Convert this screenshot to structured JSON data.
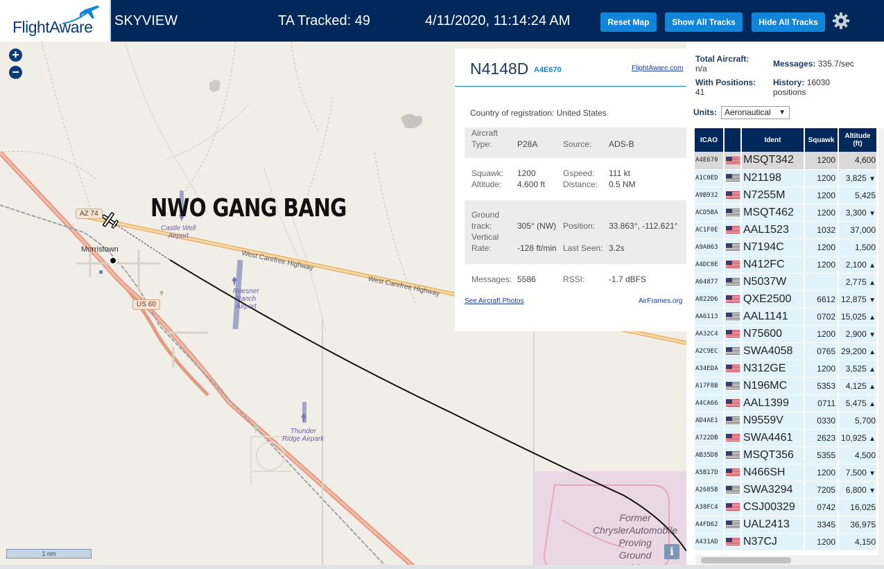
{
  "header": {
    "logo_text": "FlightAware",
    "app_title": "SKYVIEW",
    "ta_tracked": "TA Tracked: 49",
    "datetime": "4/11/2020, 11:14:24 AM",
    "reset_map": "Reset Map",
    "show_all_tracks": "Show All Tracks",
    "hide_all_tracks": "Hide All Tracks",
    "settings_icon": "gear-icon",
    "bg_color": "#00285a",
    "button_color": "#1185d9"
  },
  "map": {
    "zoom_in": "+",
    "zoom_out": "−",
    "overlay_text": "NWO GANG BANG",
    "town": "Morristown",
    "shields": [
      "AZ 74",
      "US 60"
    ],
    "roads": [
      "West Carefree Highway",
      "West Carefree Highway"
    ],
    "airports": [
      {
        "line1": "Castle Well",
        "line2": "Airport"
      },
      {
        "line1": "Roesner",
        "line2": "Ranch",
        "line3": "Airport"
      },
      {
        "line1": "Thunder",
        "line2": "Ridge Airpark"
      }
    ],
    "pink_area": [
      "Former",
      "ChryslerAutomobile",
      "Proving",
      "Ground",
      "sold to"
    ],
    "scale": "1 nm",
    "info": "i"
  },
  "detail": {
    "callsign": "N4148D",
    "icao": "A4E670",
    "flightaware_link": "FlightAware.com",
    "country_label": "Country of registration:",
    "country": "United States",
    "aircraft_type_label1": "Aircraft",
    "aircraft_type_label2": "Type:",
    "aircraft_type": "P28A",
    "source_label": "Source:",
    "source": "ADS-B",
    "squawk_label": "Squawk:",
    "squawk": "1200",
    "gspeed_label": "Gspeed:",
    "gspeed": "111 kt",
    "altitude_label": "Altitude:",
    "altitude": "4,600 ft",
    "distance_label": "Distance:",
    "distance": "0.5 NM",
    "track_label1": "Ground",
    "track_label2": "track:",
    "track": "305° (NW)",
    "position_label": "Position:",
    "position": "33.863°, -112.621°",
    "vrate_label1": "Vertical",
    "vrate_label2": "Rate:",
    "vrate": "-128 ft/min",
    "lastseen_label": "Last Seen:",
    "lastseen": "3.2s",
    "messages_label": "Messages:",
    "messages": "5586",
    "rssi_label": "RSSI:",
    "rssi": "-1.7 dBFS",
    "photos_link": "See Aircraft Photos",
    "airframes_link": "AirFrames.org"
  },
  "stats": {
    "total_label": "Total Aircraft:",
    "total": "n/a",
    "messages_label": "Messages:",
    "messages": "335.7/sec",
    "positions_label": "With Positions:",
    "positions": "41",
    "history_label": "History:",
    "history_value": "16030",
    "history_unit": "positions",
    "units_label": "Units:",
    "units_value": "Aeronautical"
  },
  "table": {
    "headers": {
      "icao": "ICAO",
      "ident": "Ident",
      "squawk": "Squawk",
      "altitude1": "Altitude",
      "altitude2": "(ft)"
    },
    "rows": [
      {
        "icao": "A4E670",
        "ident": "MSQT342",
        "squawk": "1200",
        "alt": "4,600",
        "trend": ""
      },
      {
        "icao": "A1C0ED",
        "ident": "N21198",
        "squawk": "1200",
        "alt": "3,825",
        "trend": "▼"
      },
      {
        "icao": "A9B932",
        "ident": "N7255M",
        "squawk": "1200",
        "alt": "5,425",
        "trend": ""
      },
      {
        "icao": "ACD5BA",
        "ident": "MSQT462",
        "squawk": "1200",
        "alt": "3,300",
        "trend": "▼"
      },
      {
        "icao": "AC1F0E",
        "ident": "AAL1523",
        "squawk": "1032",
        "alt": "37,000",
        "trend": ""
      },
      {
        "icao": "A9A063",
        "ident": "N7194C",
        "squawk": "1200",
        "alt": "1,500",
        "trend": ""
      },
      {
        "icao": "A4DC0E",
        "ident": "N412FC",
        "squawk": "1200",
        "alt": "2,100",
        "trend": "▲"
      },
      {
        "icao": "A64877",
        "ident": "N5037W",
        "squawk": "",
        "alt": "2,775",
        "trend": "▲"
      },
      {
        "icao": "A822D6",
        "ident": "QXE2500",
        "squawk": "6612",
        "alt": "12,875",
        "trend": "▼"
      },
      {
        "icao": "AA6113",
        "ident": "AAL1141",
        "squawk": "0702",
        "alt": "15,025",
        "trend": "▲"
      },
      {
        "icao": "AA32C4",
        "ident": "N75600",
        "squawk": "1200",
        "alt": "2,900",
        "trend": "▼"
      },
      {
        "icao": "A2C9EC",
        "ident": "SWA4058",
        "squawk": "0765",
        "alt": "29,200",
        "trend": "▲"
      },
      {
        "icao": "A34EDA",
        "ident": "N312GE",
        "squawk": "1200",
        "alt": "3,525",
        "trend": "▲"
      },
      {
        "icao": "A17F8B",
        "ident": "N196MC",
        "squawk": "5353",
        "alt": "4,125",
        "trend": "▲"
      },
      {
        "icao": "A4CA66",
        "ident": "AAL1399",
        "squawk": "0711",
        "alt": "5,475",
        "trend": "▲"
      },
      {
        "icao": "AD4AE1",
        "ident": "N9559V",
        "squawk": "0330",
        "alt": "5,700",
        "trend": ""
      },
      {
        "icao": "A722DB",
        "ident": "SWA4461",
        "squawk": "2623",
        "alt": "10,925",
        "trend": "▲"
      },
      {
        "icao": "AB35D8",
        "ident": "MSQT356",
        "squawk": "5355",
        "alt": "4,500",
        "trend": ""
      },
      {
        "icao": "A5B17D",
        "ident": "N466SH",
        "squawk": "1200",
        "alt": "7,500",
        "trend": "▼"
      },
      {
        "icao": "A2685B",
        "ident": "SWA3294",
        "squawk": "7205",
        "alt": "6,800",
        "trend": "▼"
      },
      {
        "icao": "A38FC4",
        "ident": "CSJ00329",
        "squawk": "0742",
        "alt": "16,025",
        "trend": ""
      },
      {
        "icao": "A4FD62",
        "ident": "UAL2413",
        "squawk": "3345",
        "alt": "36,975",
        "trend": ""
      },
      {
        "icao": "A431AD",
        "ident": "N37CJ",
        "squawk": "1200",
        "alt": "4,150",
        "trend": ""
      }
    ],
    "flag_icon": "us-flag-icon"
  }
}
